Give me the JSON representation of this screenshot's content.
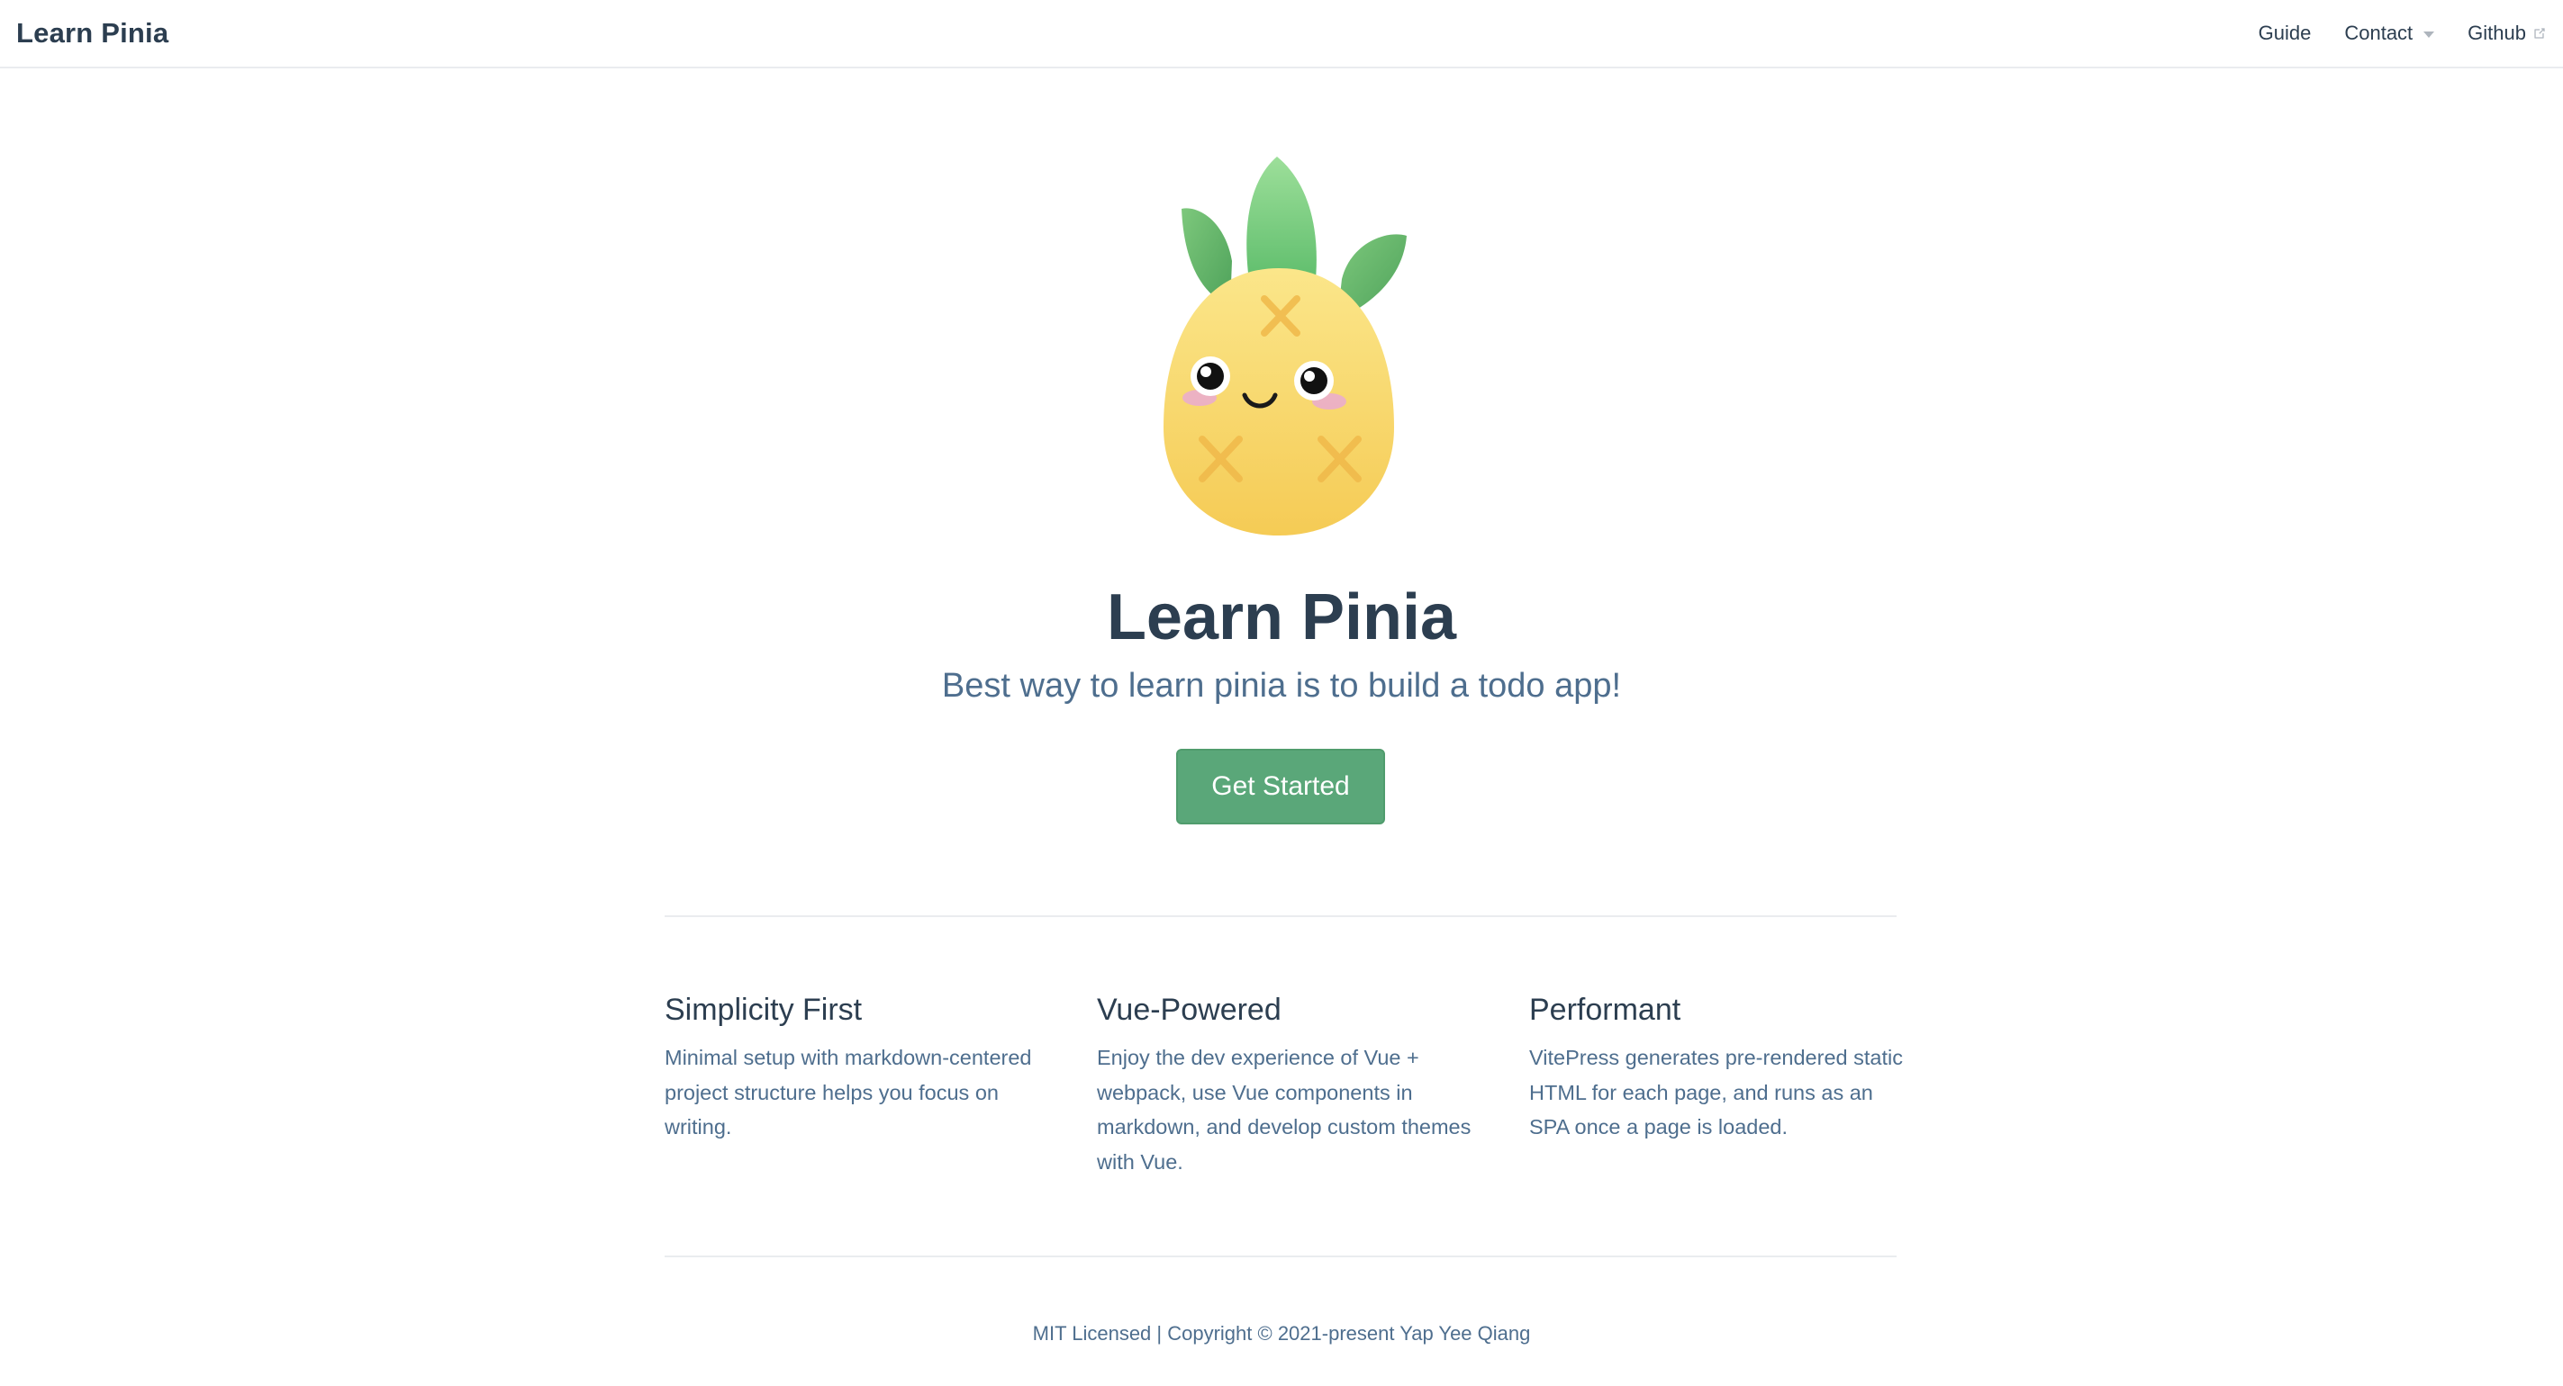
{
  "navbar": {
    "site_title": "Learn Pinia",
    "links": [
      {
        "label": "Guide"
      },
      {
        "label": "Contact",
        "icon": "chevron-down-icon"
      },
      {
        "label": "Github",
        "icon": "external-link-icon"
      }
    ]
  },
  "hero": {
    "logo": "pineapple-mascot-logo",
    "title": "Learn Pinia",
    "tagline": "Best way to learn pinia is to build a todo app!",
    "cta_label": "Get Started"
  },
  "features": [
    {
      "title": "Simplicity First",
      "details": "Minimal setup with markdown-centered project structure helps you focus on writing."
    },
    {
      "title": "Vue-Powered",
      "details": "Enjoy the dev experience of Vue + webpack, use Vue components in markdown, and develop custom themes with Vue."
    },
    {
      "title": "Performant",
      "details": "VitePress generates pre-rendered static HTML for each page, and runs as an SPA once a page is loaded."
    }
  ],
  "footer": {
    "text": "MIT Licensed | Copyright © 2021-present Yap Yee Qiang"
  },
  "colors": {
    "accent": "#5aa779",
    "text": "#2c3e50",
    "muted_text": "#4e6e8e",
    "border": "#eaecef"
  }
}
